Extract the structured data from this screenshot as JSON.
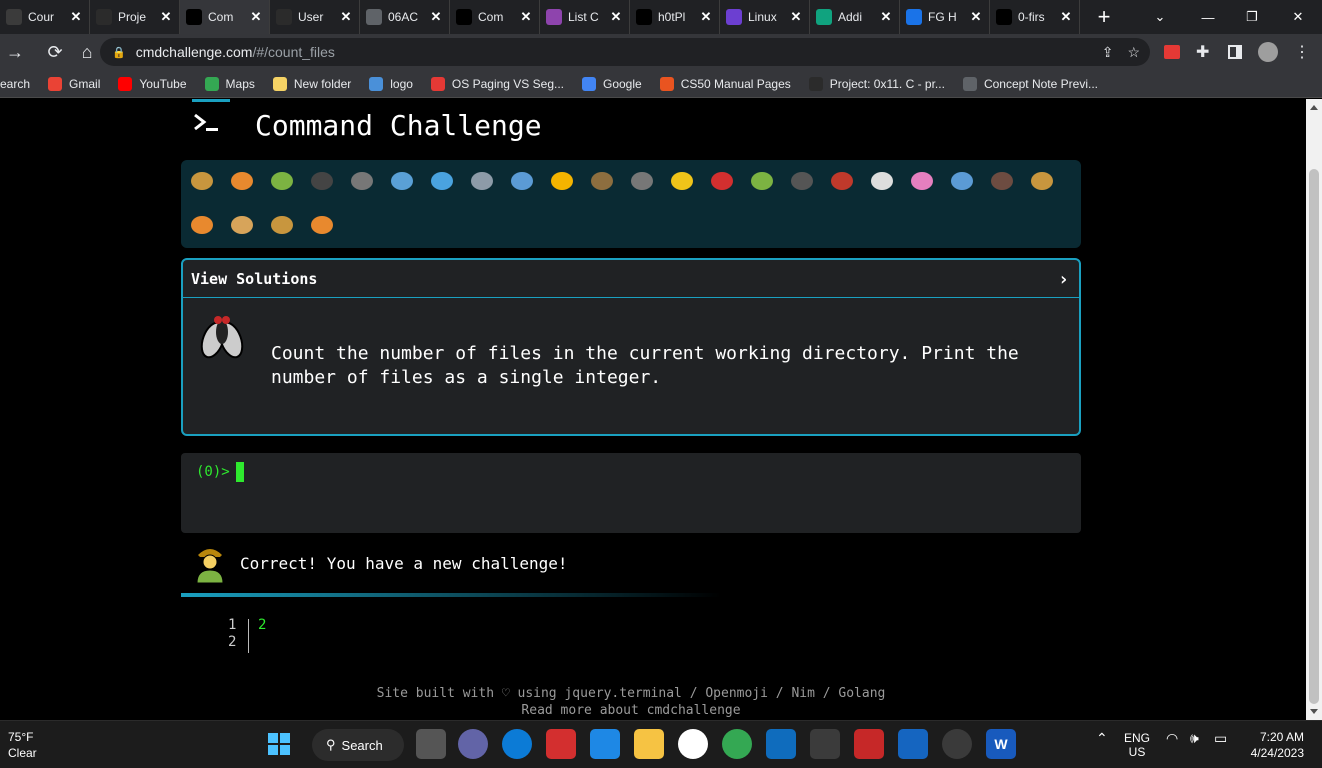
{
  "browser": {
    "tabs": [
      {
        "label": "Cour",
        "icon": "page-icon",
        "color": "#3b3b3b",
        "active": false
      },
      {
        "label": "Proje",
        "icon": "holberton-icon",
        "color": "#2b2b2b",
        "active": false
      },
      {
        "label": "Com",
        "icon": "terminal-icon",
        "color": "#000000",
        "active": true
      },
      {
        "label": "User",
        "icon": "holberton-icon",
        "color": "#2b2b2b",
        "active": false
      },
      {
        "label": "06AC",
        "icon": "globe-icon",
        "color": "#5f6368",
        "active": false
      },
      {
        "label": "Com",
        "icon": "terminal-icon",
        "color": "#000000",
        "active": false
      },
      {
        "label": "List C",
        "icon": "triangle-icon",
        "color": "#8e44ad",
        "active": false
      },
      {
        "label": "h0tPl",
        "icon": "github-icon",
        "color": "#000000",
        "active": false
      },
      {
        "label": "Linux",
        "icon": "hashnode-icon",
        "color": "#6c3fd1",
        "active": false
      },
      {
        "label": "Addi",
        "icon": "openai-icon",
        "color": "#10a37f",
        "active": false
      },
      {
        "label": "FG H",
        "icon": "fg-icon",
        "color": "#1a73e8",
        "active": false
      },
      {
        "label": "0-firs",
        "icon": "github-icon",
        "color": "#000000",
        "active": false
      }
    ],
    "url_host": "cmdchallenge.com",
    "url_path": "/#/count_files",
    "bookmarks": [
      {
        "label": "earch",
        "icon": "none",
        "color": "#35363a"
      },
      {
        "label": "Gmail",
        "icon": "gmail-icon",
        "color": "#ea4335"
      },
      {
        "label": "YouTube",
        "icon": "youtube-icon",
        "color": "#ff0000"
      },
      {
        "label": "Maps",
        "icon": "maps-icon",
        "color": "#34a853"
      },
      {
        "label": "New folder",
        "icon": "folder-icon",
        "color": "#f6d365"
      },
      {
        "label": "logo",
        "icon": "diamond-icon",
        "color": "#4a90d9"
      },
      {
        "label": "OS Paging VS Seg...",
        "icon": "v-icon",
        "color": "#e53935"
      },
      {
        "label": "Google",
        "icon": "google-icon",
        "color": "#4285f4"
      },
      {
        "label": "CS50 Manual Pages",
        "icon": "ubuntu-icon",
        "color": "#e95420"
      },
      {
        "label": "Project: 0x11. C - pr...",
        "icon": "holberton-icon",
        "color": "#2b2b2b"
      },
      {
        "label": "Concept Note Previ...",
        "icon": "globe-icon",
        "color": "#5f6368"
      }
    ]
  },
  "site": {
    "title": "Command Challenge",
    "solutions_label": "View Solutions",
    "task": "Count the number of files in the current working directory. Print the number of files as a single integer.",
    "prompt": "(0)>",
    "correct_msg": "Correct! You have a new challenge!",
    "output_lines": [
      "1",
      "2"
    ],
    "output_value": "2",
    "footer_line1": "Site built with ♡ using jquery.terminal / Openmoji / Nim / Golang",
    "footer_line2": "Read more about cmdchallenge"
  },
  "animals": [
    "snail-icon",
    "butterfly-icon",
    "caterpillar-icon",
    "ant-icon",
    "spider-web-icon",
    "whale-icon",
    "dolphin-icon",
    "shark-icon",
    "fish-icon",
    "tropical-fish-icon",
    "blowfish-icon",
    "wolf-icon",
    "bee-icon",
    "ladybug-icon",
    "worm-icon",
    "spider-icon",
    "scorpion-icon",
    "fly-icon",
    "earthworm-icon",
    "microbe-icon",
    "monkey-icon",
    "dog-icon",
    "fox-icon",
    "cat-icon",
    "lion-icon",
    "tiger-icon"
  ],
  "taskbar": {
    "temp": "75°F",
    "weather": "Clear",
    "search_label": "Search",
    "lang1": "ENG",
    "lang2": "US",
    "time": "7:20 AM",
    "date": "4/24/2023"
  }
}
